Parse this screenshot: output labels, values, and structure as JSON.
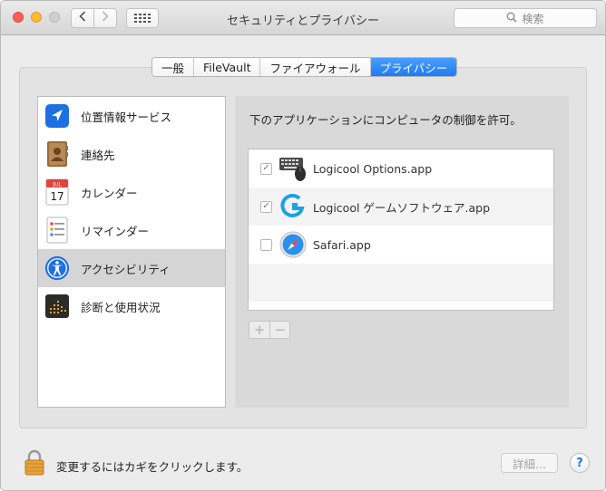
{
  "window": {
    "title": "セキュリティとプライバシー",
    "search_placeholder": "検索"
  },
  "tabs": [
    {
      "label": "一般",
      "active": false
    },
    {
      "label": "FileVault",
      "active": false
    },
    {
      "label": "ファイアウォール",
      "active": false
    },
    {
      "label": "プライバシー",
      "active": true
    }
  ],
  "sidebar": {
    "items": [
      {
        "label": "位置情報サービス",
        "icon": "location-arrow-icon",
        "selected": false
      },
      {
        "label": "連絡先",
        "icon": "contacts-book-icon",
        "selected": false
      },
      {
        "label": "カレンダー",
        "icon": "calendar-icon",
        "selected": false
      },
      {
        "label": "リマインダー",
        "icon": "reminders-icon",
        "selected": false
      },
      {
        "label": "アクセシビリティ",
        "icon": "accessibility-icon",
        "selected": true
      },
      {
        "label": "診断と使用状況",
        "icon": "diagnostics-icon",
        "selected": false
      }
    ]
  },
  "calendar_icon": {
    "month": "JUL",
    "day": "17"
  },
  "main": {
    "prompt": "下のアプリケーションにコンピュータの制御を許可。",
    "apps": [
      {
        "name": "Logicool Options.app",
        "checked": true,
        "icon": "keyboard-mouse-icon"
      },
      {
        "name": "Logicool ゲームソフトウェア.app",
        "checked": true,
        "icon": "logicool-g-icon"
      },
      {
        "name": "Safari.app",
        "checked": false,
        "icon": "safari-compass-icon"
      }
    ],
    "add_label": "+",
    "remove_label": "−"
  },
  "footer": {
    "lock_text": "変更するにはカギをクリックします。",
    "details_label": "詳細...",
    "help_label": "?"
  },
  "colors": {
    "accent": "#1d7cf5",
    "selected_row": "#d5d5d5"
  }
}
